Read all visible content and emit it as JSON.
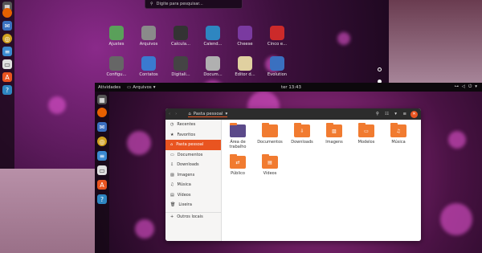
{
  "search": {
    "placeholder": "Digite para pesquisar..."
  },
  "apps": [
    {
      "label": "Ajustes",
      "icon": "tweaks-icon",
      "color": "#5aa05a"
    },
    {
      "label": "Arquivos",
      "icon": "files-icon",
      "color": "#8a8a8a"
    },
    {
      "label": "Calcula...",
      "icon": "calculator-icon",
      "color": "#333333"
    },
    {
      "label": "Calend...",
      "icon": "calendar-icon",
      "color": "#2e86c1"
    },
    {
      "label": "Cheese",
      "icon": "cheese-icon",
      "color": "#7a3aa0"
    },
    {
      "label": "Cinco e...",
      "icon": "five-or-more-icon",
      "color": "#cc2a2a"
    },
    {
      "label": "Configu...",
      "icon": "settings-icon",
      "color": "#666666"
    },
    {
      "label": "Contatos",
      "icon": "contacts-icon",
      "color": "#3a7ad0"
    },
    {
      "label": "Digitali...",
      "icon": "scanner-icon",
      "color": "#444444"
    },
    {
      "label": "Docum...",
      "icon": "document-viewer-icon",
      "color": "#b0b0b0"
    },
    {
      "label": "Editor d...",
      "icon": "text-editor-icon",
      "color": "#e0d0a0"
    },
    {
      "label": "Evolution",
      "icon": "evolution-icon",
      "color": "#3a70c0"
    }
  ],
  "topbar": {
    "activities": "Atividades",
    "app": "Arquivos",
    "clock": "ter 13:43"
  },
  "files": {
    "location": "Pasta pessoal",
    "sidebar": [
      {
        "label": "Recentes"
      },
      {
        "label": "Favoritos"
      },
      {
        "label": "Pasta pessoal"
      },
      {
        "label": "Documentos"
      },
      {
        "label": "Downloads"
      },
      {
        "label": "Imagens"
      },
      {
        "label": "Música"
      },
      {
        "label": "Vídeos"
      },
      {
        "label": "Lixeira"
      },
      {
        "label": "Outros locais"
      }
    ],
    "folders": [
      {
        "label": "Área de trabalho"
      },
      {
        "label": "Documentos"
      },
      {
        "label": "Downloads"
      },
      {
        "label": "Imagens"
      },
      {
        "label": "Modelos"
      },
      {
        "label": "Música"
      },
      {
        "label": "Público"
      },
      {
        "label": "Vídeos"
      }
    ]
  },
  "colors": {
    "accent": "#e95420",
    "folder": "#f17b30"
  }
}
